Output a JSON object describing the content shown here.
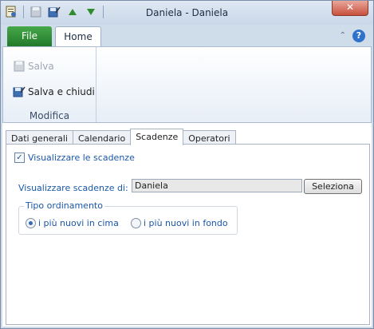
{
  "window": {
    "title": "Daniela - Daniela",
    "close_label": "✕"
  },
  "ribbon": {
    "tabs": {
      "file": "File",
      "home": "Home"
    },
    "help_label": "?",
    "group": {
      "label": "Modifica",
      "save_label": "Salva",
      "save_close_label": "Salva e chiudi"
    }
  },
  "doc_tabs": [
    "Dati generali",
    "Calendario",
    "Scadenze",
    "Operatori"
  ],
  "panel": {
    "show_deadlines_label": "Visualizzare le scadenze",
    "show_deadlines_of_label": "Visualizzare scadenze di:",
    "person_value": "Daniela",
    "select_button": "Seleziona",
    "order_legend": "Tipo ordinamento",
    "order_options": [
      "i più nuovi in cima",
      "i più nuovi in fondo"
    ],
    "order_selected": "i più nuovi in cima"
  },
  "colors": {
    "file_tab": "#2f8f36",
    "accent_text": "#1a57a8",
    "close": "#c8513c"
  }
}
